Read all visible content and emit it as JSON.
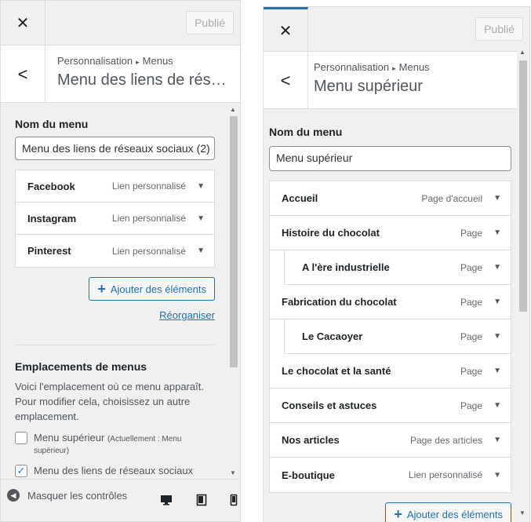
{
  "left": {
    "publish_label": "Publié",
    "breadcrumb": {
      "root": "Personnalisation",
      "section": "Menus"
    },
    "title": "Menu des liens de réseaux sociaux",
    "menu_name_label": "Nom du menu",
    "menu_name_value": "Menu des liens de réseaux sociaux (2)",
    "items": [
      {
        "title": "Facebook",
        "type": "Lien personnalisé"
      },
      {
        "title": "Instagram",
        "type": "Lien personnalisé"
      },
      {
        "title": "Pinterest",
        "type": "Lien personnalisé"
      }
    ],
    "add_items_label": "Ajouter des éléments",
    "reorder_label": "Réorganiser",
    "locations_title": "Emplacements de menus",
    "locations_desc": "Voici l'emplacement où ce menu apparaît. Pour modifier cela, choisissez un autre emplacement.",
    "locations": [
      {
        "label": "Menu supérieur",
        "note": "(Actuellement : Menu supérieur)",
        "checked": false
      },
      {
        "label": "Menu des liens de réseaux sociaux",
        "note": "",
        "checked": true
      }
    ],
    "hide_controls_label": "Masquer les contrôles"
  },
  "right": {
    "publish_label": "Publié",
    "breadcrumb": {
      "root": "Personnalisation",
      "section": "Menus"
    },
    "title": "Menu supérieur",
    "menu_name_label": "Nom du menu",
    "menu_name_value": "Menu supérieur",
    "items": [
      {
        "title": "Accueil",
        "type": "Page d'accueil",
        "sub": false
      },
      {
        "title": "Histoire du chocolat",
        "type": "Page",
        "sub": false
      },
      {
        "title": "A l'ère industrielle",
        "type": "Page",
        "sub": true
      },
      {
        "title": "Fabrication du chocolat",
        "type": "Page",
        "sub": false
      },
      {
        "title": "Le Cacaoyer",
        "type": "Page",
        "sub": true
      },
      {
        "title": "Le chocolat et la santé",
        "type": "Page",
        "sub": false
      },
      {
        "title": "Conseils et astuces",
        "type": "Page",
        "sub": false
      },
      {
        "title": "Nos articles",
        "type": "Page des articles",
        "sub": false
      },
      {
        "title": "E-boutique",
        "type": "Lien personnalisé",
        "sub": false
      }
    ],
    "add_items_label": "Ajouter des éléments"
  },
  "icons": {
    "close": "close-icon",
    "back": "chevron-left-icon",
    "dropdown": "triangle-down-icon",
    "add": "plus-icon",
    "collapse": "collapse-circle-icon",
    "desktop": "desktop-icon",
    "tablet": "tablet-icon",
    "mobile": "mobile-icon"
  },
  "colors": {
    "accent": "#2271b1",
    "panel_bg": "#f0f0f1",
    "border": "#dcdcde"
  }
}
